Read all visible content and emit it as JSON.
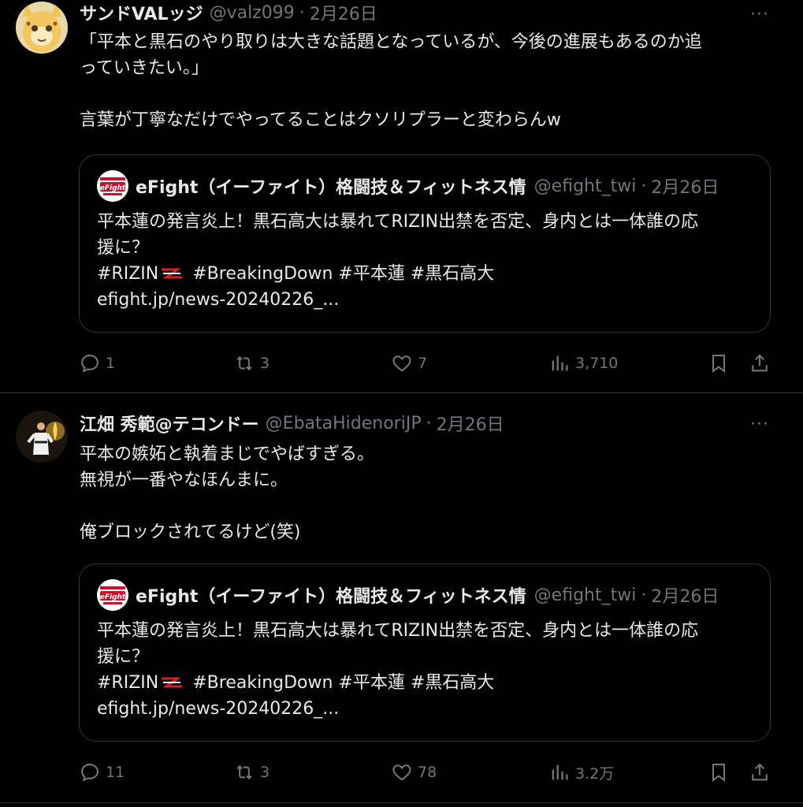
{
  "tweets": [
    {
      "name": "サンドVALッジ",
      "handle": "@valz099",
      "sep": "·",
      "date": "2月26日",
      "more": "···",
      "lines": [
        "「平本と黒石のやり取りは大きな話題となっているが、今後の進展もあるのか追",
        "っていきたい。」",
        "",
        "言葉が丁寧なだけでやってることはクソリプラーと変わらんw"
      ],
      "quote": {
        "name": "eFight（イーファイト）格闘技＆フィットネス情",
        "handle": "@efight_twi",
        "sep": "·",
        "date": "2月26日",
        "logo_text": "eFight",
        "line1": "平本蓮の発言炎上！黒石高大は暴れてRIZIN出禁を否定、身内とは一体誰の応",
        "line2": "援に？",
        "tag_rizin": "#RIZIN",
        "tags_rest": "#BreakingDown #平本蓮 #黒石高大",
        "link": "efight.jp/news-20240226_..."
      },
      "stats": {
        "replies": "1",
        "retweets": "3",
        "likes": "7",
        "views": "3,710"
      }
    },
    {
      "name": "江畑 秀範@テコンドー",
      "handle": "@EbataHidenoriJP",
      "sep": "·",
      "date": "2月26日",
      "more": "···",
      "lines": [
        "平本の嫉妬と執着まじでやばすぎる。",
        "無視が一番やなほんまに。",
        "",
        "俺ブロックされてるけど(笑)"
      ],
      "quote": {
        "name": "eFight（イーファイト）格闘技＆フィットネス情",
        "handle": "@efight_twi",
        "sep": "·",
        "date": "2月26日",
        "logo_text": "eFight",
        "line1": "平本蓮の発言炎上！黒石高大は暴れてRIZIN出禁を否定、身内とは一体誰の応",
        "line2": "援に？",
        "tag_rizin": "#RIZIN",
        "tags_rest": "#BreakingDown #平本蓮 #黒石高大",
        "link": "efight.jp/news-20240226_..."
      },
      "stats": {
        "replies": "11",
        "retweets": "3",
        "likes": "78",
        "views": "3.2万"
      }
    }
  ],
  "colors": {
    "background": "#000000",
    "text": "#e7e9ea",
    "muted": "#71767b",
    "border": "#2f3336"
  },
  "icons": [
    "more-icon",
    "reply-icon",
    "retweet-icon",
    "like-icon",
    "views-icon",
    "bookmark-icon",
    "share-icon",
    "rizin-logo-icon"
  ]
}
